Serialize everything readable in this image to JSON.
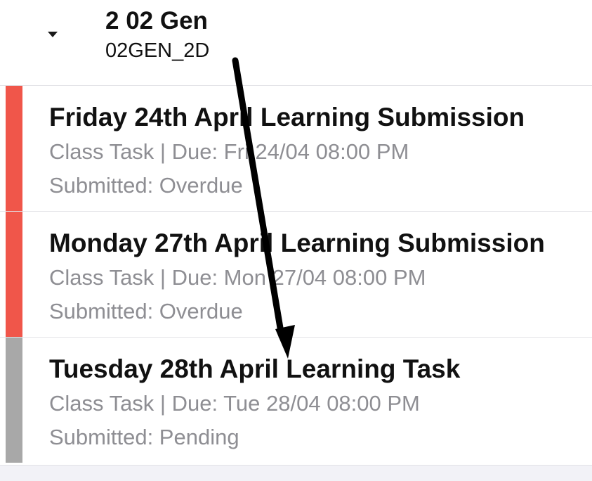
{
  "group": {
    "title": "2 02 Gen",
    "code": "02GEN_2D"
  },
  "tasks": [
    {
      "title": "Friday 24th April Learning Submission",
      "meta": "Class Task | Due: Fri 24/04 08:00 PM",
      "status": "Submitted: Overdue",
      "color": "#f0564a"
    },
    {
      "title": "Monday 27th April Learning Submission",
      "meta": "Class Task | Due: Mon 27/04 08:00 PM",
      "status": "Submitted: Overdue",
      "color": "#f0564a"
    },
    {
      "title": "Tuesday 28th April Learning Task",
      "meta": "Class Task | Due: Tue 28/04 08:00 PM",
      "status": "Submitted: Pending",
      "color": "#a8a8a8"
    }
  ],
  "colors": {
    "overdue": "#f0564a",
    "pending": "#a8a8a8",
    "secondary_text": "#8e8e93"
  },
  "icons": {
    "collapse": "caret-down-icon",
    "annotation": "arrow-icon"
  }
}
